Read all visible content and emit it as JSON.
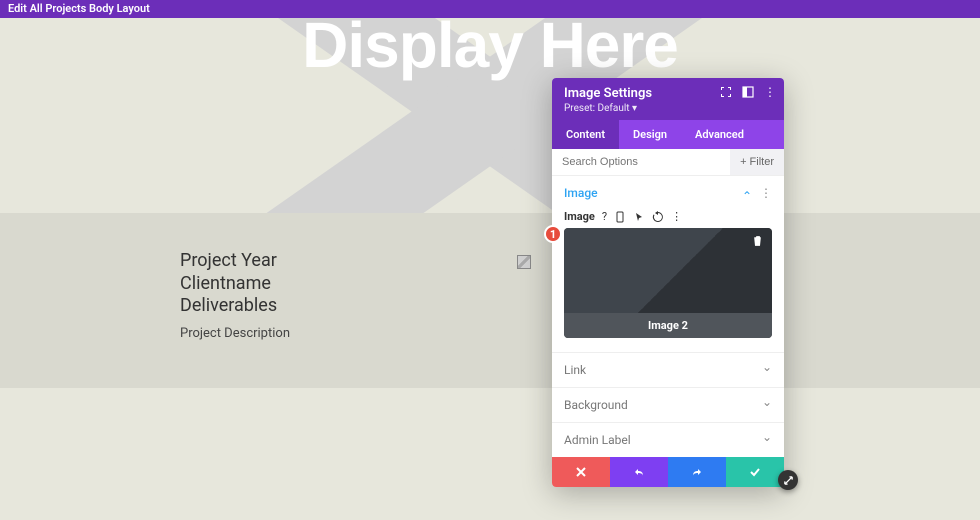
{
  "topbar": {
    "title": "Edit All Projects Body Layout"
  },
  "hero": {
    "text": "Display Here"
  },
  "content": {
    "line1": "Project Year",
    "line2": "Clientname",
    "line3": "Deliverables",
    "desc": "Project Description"
  },
  "badge": {
    "num": "1"
  },
  "panel": {
    "title": "Image Settings",
    "preset": "Preset: Default",
    "tabs": {
      "content": "Content",
      "design": "Design",
      "advanced": "Advanced"
    },
    "search": {
      "placeholder": "Search Options",
      "filter": "Filter"
    },
    "sections": {
      "image": {
        "title": "Image",
        "field_label": "Image",
        "preview_caption": "Image 2"
      },
      "link": {
        "title": "Link"
      },
      "background": {
        "title": "Background"
      },
      "admin_label": {
        "title": "Admin Label"
      }
    }
  }
}
